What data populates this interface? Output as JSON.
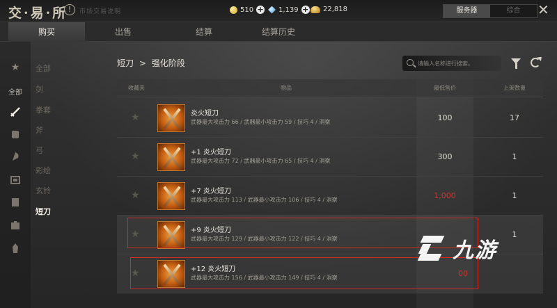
{
  "app": {
    "logo_text": "交·易·所",
    "help_text": "市场交易说明"
  },
  "currencies": [
    {
      "icon": "gold-coin-icon",
      "value": "510"
    },
    {
      "icon": "blue-gem-icon",
      "value": "1,139"
    },
    {
      "icon": "coin-pile-icon",
      "value": "22,818"
    }
  ],
  "server_tabs": [
    {
      "label": "服务器",
      "active": true
    },
    {
      "label": "综合",
      "active": false
    }
  ],
  "main_tabs": [
    {
      "label": "购买",
      "active": true
    },
    {
      "label": "出售",
      "active": false
    },
    {
      "label": "结算",
      "active": false
    },
    {
      "label": "结算历史",
      "active": false
    }
  ],
  "sidebar": {
    "all_label": "全部",
    "icons": [
      "star-icon",
      "sword-icon",
      "glove-icon",
      "axe-icon",
      "bow-icon",
      "wand-icon",
      "scroll-icon",
      "book-icon",
      "tower-icon"
    ],
    "categories": [
      {
        "label": "全部",
        "active": false
      },
      {
        "label": "剑",
        "active": false
      },
      {
        "label": "拳套",
        "active": false
      },
      {
        "label": "斧",
        "active": false
      },
      {
        "label": "弓",
        "active": false
      },
      {
        "label": "彩绘",
        "active": false
      },
      {
        "label": "玄铃",
        "active": false
      },
      {
        "label": "短刀",
        "active": true
      }
    ]
  },
  "breadcrumb": {
    "parent": "短刀",
    "separator": ">",
    "current": "强化阶段"
  },
  "search": {
    "placeholder": "请输入名称进行搜索。"
  },
  "table": {
    "headers": {
      "favorite": "收藏夹",
      "item": "物品",
      "price": "最低售价",
      "quantity": "上架数量"
    },
    "rows": [
      {
        "name": "炎火短刀",
        "stats": "武器最大攻击力 66  / 武器最小攻击力 59  / 技巧 4  / 洞察",
        "price": "100",
        "quantity": "17",
        "price_red": false
      },
      {
        "name": "+1 炎火短刀",
        "stats": "武器最大攻击力 72  / 武器最小攻击力 65  / 技巧 4  / 洞察",
        "price": "300",
        "quantity": "1",
        "price_red": false
      },
      {
        "name": "+7 炎火短刀",
        "stats": "武器最大攻击力 113  / 武器最小攻击力 106  / 技巧 4  / 洞察",
        "price": "1,000",
        "quantity": "1",
        "price_red": true
      },
      {
        "name": "+9 炎火短刀",
        "stats": "武器最大攻击力 129  / 武器最小攻击力 122  / 技巧 4  / 洞察",
        "price": "",
        "quantity": "1",
        "price_red": true
      },
      {
        "name": "+12 炎火短刀",
        "stats": "武器最大攻击力 156  / 武器最小攻击力 149  / 技巧 4  / 洞察",
        "price": "00",
        "quantity": "",
        "price_red": true
      }
    ]
  },
  "watermark": {
    "text": "九游"
  }
}
